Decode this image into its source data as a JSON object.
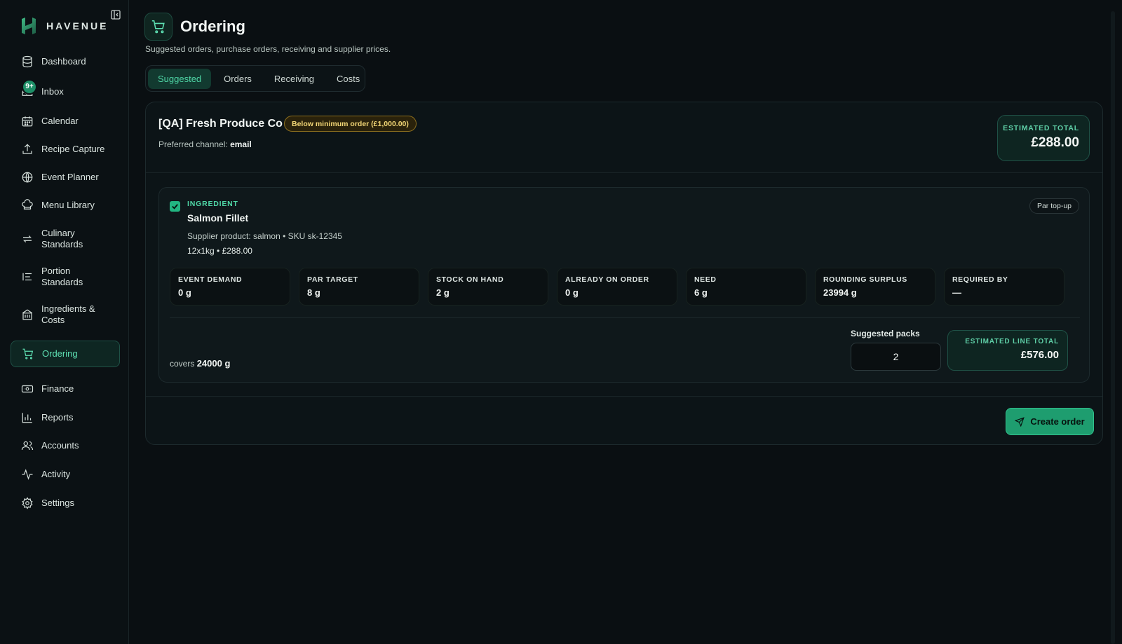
{
  "brand": {
    "name": "HAVENUE"
  },
  "sidebar": {
    "items": [
      {
        "key": "dashboard",
        "label": "Dashboard",
        "icon": "database-icon"
      },
      {
        "key": "inbox",
        "label": "Inbox",
        "icon": "inbox-icon",
        "badge": "9+"
      },
      {
        "key": "calendar",
        "label": "Calendar",
        "icon": "calendar-icon"
      },
      {
        "key": "recipe-capture",
        "label": "Recipe Capture",
        "icon": "upload-icon"
      },
      {
        "key": "event-planner",
        "label": "Event Planner",
        "icon": "globe-icon"
      },
      {
        "key": "menu-library",
        "label": "Menu Library",
        "icon": "chef-hat-icon"
      },
      {
        "key": "culinary-standards",
        "label": "Culinary Standards",
        "icon": "arrows-swap-icon"
      },
      {
        "key": "portion-standards",
        "label": "Portion Standards",
        "icon": "list-icon"
      },
      {
        "key": "ingredients-costs",
        "label": "Ingredients & Costs",
        "icon": "building-icon"
      },
      {
        "key": "ordering",
        "label": "Ordering",
        "icon": "cart-icon",
        "active": true
      },
      {
        "key": "finance",
        "label": "Finance",
        "icon": "banknote-icon"
      },
      {
        "key": "reports",
        "label": "Reports",
        "icon": "bar-chart-icon"
      },
      {
        "key": "accounts",
        "label": "Accounts",
        "icon": "users-icon"
      },
      {
        "key": "activity",
        "label": "Activity",
        "icon": "activity-icon"
      },
      {
        "key": "settings",
        "label": "Settings",
        "icon": "gear-icon"
      }
    ]
  },
  "header": {
    "title": "Ordering",
    "subtitle": "Suggested orders, purchase orders, receiving and supplier prices."
  },
  "tabs": [
    {
      "label": "Suggested",
      "active": true
    },
    {
      "label": "Orders"
    },
    {
      "label": "Receiving"
    },
    {
      "label": "Costs"
    }
  ],
  "supplier": {
    "name": "[QA] Fresh Produce Co",
    "min_badge": "Below minimum order (£1,000.00)",
    "channel_label": "Preferred channel:",
    "channel_value": "email",
    "estimated_total_label": "ESTIMATED TOTAL",
    "estimated_total_value": "£288.00"
  },
  "line_item": {
    "checked": true,
    "type_label": "INGREDIENT",
    "name": "Salmon Fillet",
    "supplier_product": "Supplier product: salmon • SKU sk-12345",
    "pack_info": "12x1kg • £288.00",
    "reason_badge": "Par top-up",
    "stats": [
      {
        "label": "EVENT DEMAND",
        "value": "0 g"
      },
      {
        "label": "PAR TARGET",
        "value": "8 g"
      },
      {
        "label": "STOCK ON HAND",
        "value": "2 g"
      },
      {
        "label": "ALREADY ON ORDER",
        "value": "0 g"
      },
      {
        "label": "NEED",
        "value": "6 g"
      },
      {
        "label": "ROUNDING SURPLUS",
        "value": "23994 g"
      },
      {
        "label": "REQUIRED BY",
        "value": "—"
      }
    ],
    "covers_label": "covers",
    "covers_value": "24000 g",
    "suggested_packs_label": "Suggested packs",
    "suggested_packs_value": "2",
    "line_total_label": "ESTIMATED LINE TOTAL",
    "line_total_value": "£576.00"
  },
  "actions": {
    "create_order_label": "Create order"
  },
  "colors": {
    "accent": "#4fd6a6",
    "warning": "#f3d776",
    "background": "#0a0f12"
  }
}
